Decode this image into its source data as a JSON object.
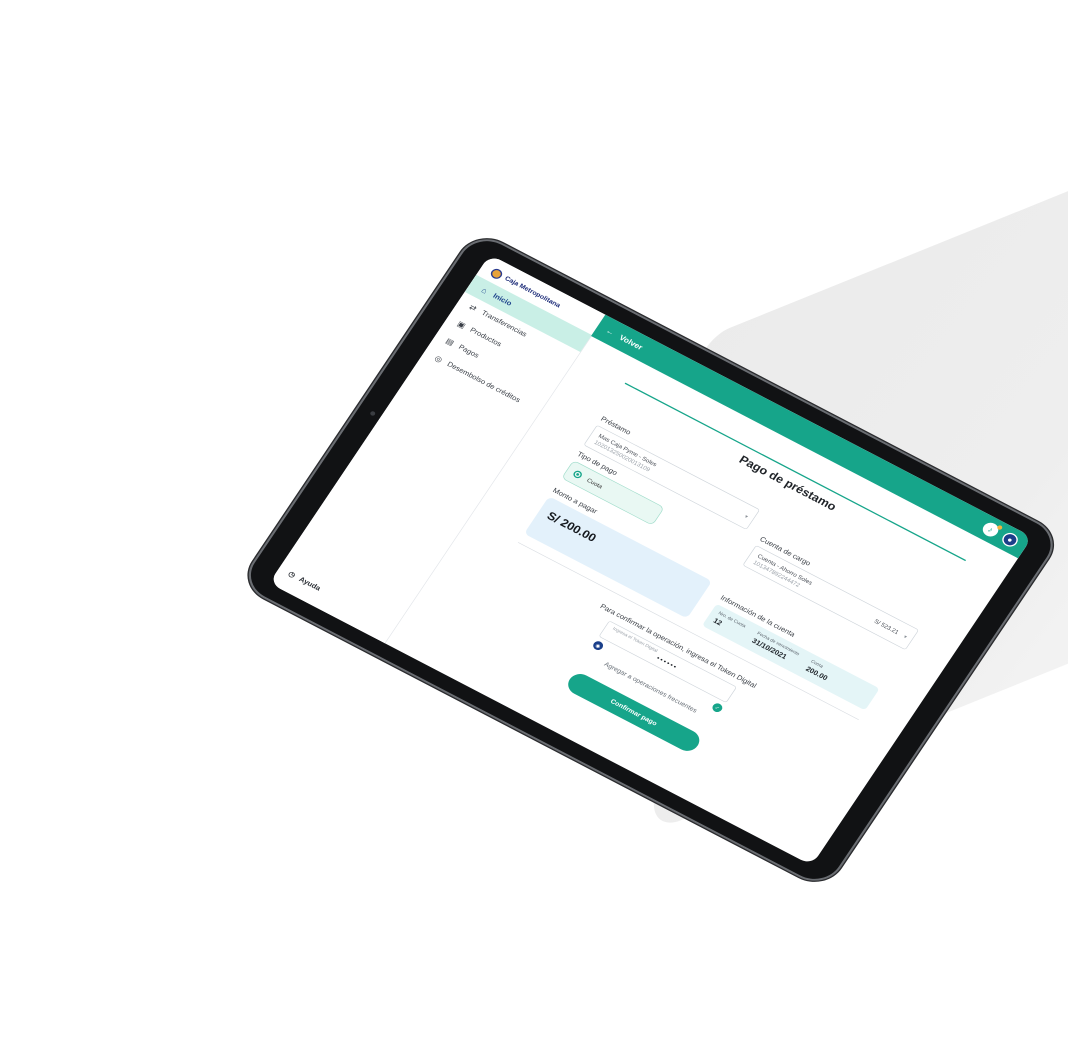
{
  "brand": {
    "name": "Caja Metropolitana",
    "tagline": ""
  },
  "sidebar": {
    "items": [
      {
        "label": "Inicio",
        "icon": "home-icon",
        "active": true
      },
      {
        "label": "Transferencias",
        "icon": "transfer-icon",
        "active": false
      },
      {
        "label": "Productos",
        "icon": "wallet-icon",
        "active": false
      },
      {
        "label": "Pagos",
        "icon": "card-icon",
        "active": false
      },
      {
        "label": "Desembolso de créditos",
        "icon": "money-icon",
        "active": false
      }
    ],
    "help_label": "Ayuda"
  },
  "header": {
    "back_label": "Volver"
  },
  "form": {
    "title": "Pago de préstamo",
    "loan": {
      "label": "Préstamo",
      "name": "Mas Caja Pyme - Soles",
      "number": "102013250020013109"
    },
    "payment_type": {
      "label": "Tipo de pago",
      "option": "Cuota"
    },
    "charge_account": {
      "label": "Cuenta de cargo",
      "name": "Cuenta - Ahorro Soles",
      "number": "101347892244472",
      "balance": "S/ 523.21"
    },
    "amount": {
      "label": "Monto a pagar",
      "value": "S/ 200.00"
    },
    "account_info": {
      "title": "Información de la cuenta",
      "installment_no_label": "Nro. de Cuota",
      "installment_no": "12",
      "due_date_label": "Fecha de vencimiento",
      "due_date": "31/10/2021",
      "installment_label": "Cuota",
      "installment_value": "200.00"
    },
    "confirm_text": "Para confirmar la operación, ingresa el Token Digital",
    "token": {
      "placeholder": "Ingresa el Token Digital",
      "value": "••••••"
    },
    "frequent_label": "Agregar a operaciones frecuentes",
    "submit_label": "Confirmar pago"
  },
  "colors": {
    "primary": "#16a58a",
    "navy": "#1a3f8a",
    "amount_bg": "#e3f1fb",
    "active_nav": "#c9efe6"
  }
}
